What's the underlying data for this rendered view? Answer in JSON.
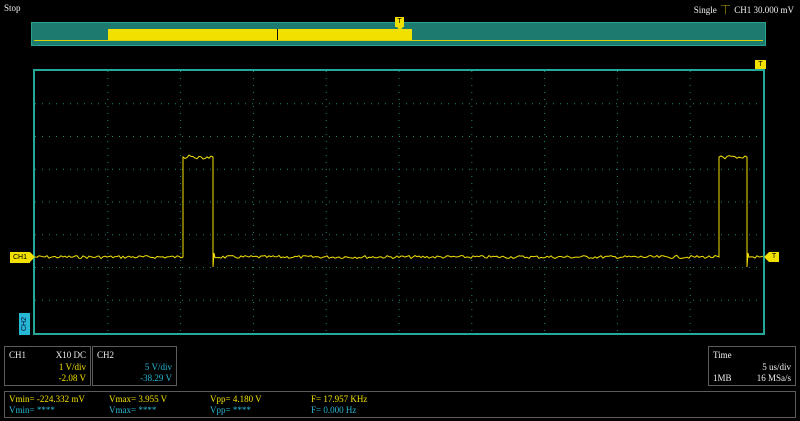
{
  "status": {
    "run_state": "Stop"
  },
  "trigger": {
    "mode": "Single",
    "source": "CH1",
    "level": "30.000 mV",
    "position_marker": "T"
  },
  "markers": {
    "ch1": "CH1",
    "ch2": "CH2",
    "trig_level": "T",
    "right_top": "T"
  },
  "colors": {
    "ch1": "#f2e000",
    "ch2": "#27b8d6",
    "grid": "#23a89a",
    "overview_bg": "#1c7b6e"
  },
  "ch1": {
    "label": "CH1",
    "coupling": "X10  DC",
    "scale": "1 V/div",
    "offset": "-2.08 V"
  },
  "ch2": {
    "label": "CH2",
    "scale": "5 V/div",
    "offset": "-38.29 V"
  },
  "timebase": {
    "label": "Time",
    "scale": "5 us/div",
    "memory": "1MB",
    "sample_rate": "16 MSa/s"
  },
  "measurements": {
    "ch1": {
      "vmin": "Vmin= -224.332 mV",
      "vmax": "Vmax= 3.955 V",
      "vpp": "Vpp= 4.180 V",
      "freq": "F= 17.957 KHz"
    },
    "ch2": {
      "vmin": "Vmin= ****",
      "vmax": "Vmax= ****",
      "vpp": "Vpp= ****",
      "freq": "F= 0.000 Hz"
    }
  },
  "icons": {
    "trigger_edge": "rising-edge-icon"
  }
}
